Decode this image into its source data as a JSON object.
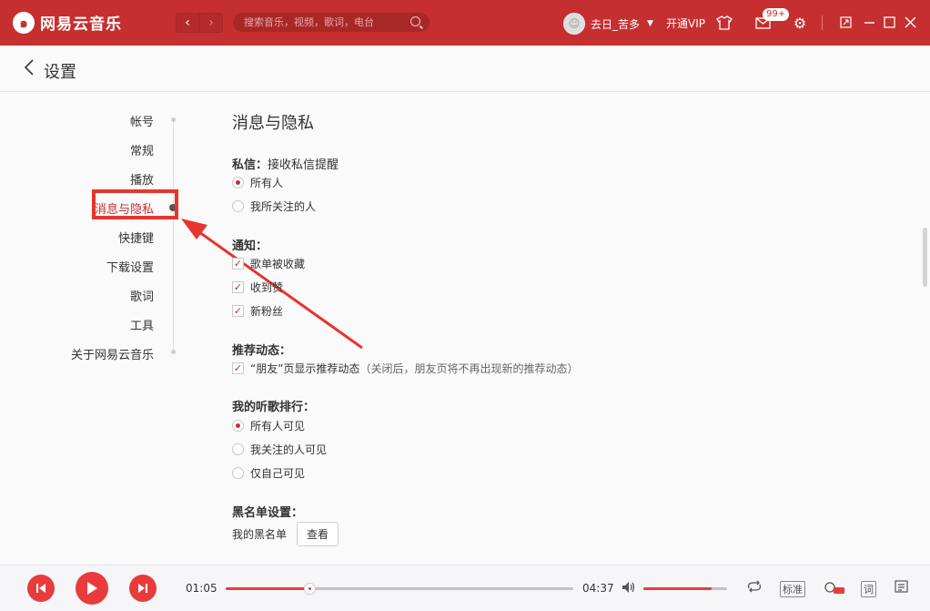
{
  "app": {
    "name": "网易云音乐"
  },
  "topbar": {
    "search_placeholder": "搜索音乐，视频，歌词，电台",
    "username": "去日_苦多",
    "vip": "开通VIP",
    "badge": "99+"
  },
  "header": {
    "title": "设置"
  },
  "sidebar": {
    "items": [
      {
        "label": "帐号"
      },
      {
        "label": "常规"
      },
      {
        "label": "播放"
      },
      {
        "label": "消息与隐私"
      },
      {
        "label": "快捷键"
      },
      {
        "label": "下载设置"
      },
      {
        "label": "歌词"
      },
      {
        "label": "工具"
      },
      {
        "label": "关于网易云音乐"
      }
    ],
    "active_index": 3
  },
  "content": {
    "section_title": "消息与隐私",
    "private_msg": {
      "title": "私信：",
      "subtitle": "接收私信提醒",
      "options": [
        {
          "label": "所有人",
          "selected": true
        },
        {
          "label": "我所关注的人",
          "selected": false
        }
      ]
    },
    "notify": {
      "title": "通知：",
      "options": [
        {
          "label": "歌单被收藏",
          "checked": true
        },
        {
          "label": "收到赞",
          "checked": true
        },
        {
          "label": "新粉丝",
          "checked": true
        }
      ]
    },
    "recommend": {
      "title": "推荐动态：",
      "label": "“朋友”页显示推荐动态",
      "hint": "（关闭后，朋友页将不再出现新的推荐动态）",
      "checked": true
    },
    "ranking": {
      "title": "我的听歌排行：",
      "options": [
        {
          "label": "所有人可见",
          "selected": true
        },
        {
          "label": "我关注的人可见",
          "selected": false
        },
        {
          "label": "仅自己可见",
          "selected": false
        }
      ]
    },
    "blacklist": {
      "title": "黑名单设置：",
      "label": "我的黑名单",
      "button": "查看"
    }
  },
  "player": {
    "current_time": "01:05",
    "total_time": "04:37",
    "progress": 0.24,
    "volume": 0.82,
    "quality": "标准",
    "lyric": "词"
  },
  "colors": {
    "brand": "#c62f2f",
    "accent": "#e83c3c",
    "highlight_box": "#e8342f"
  }
}
